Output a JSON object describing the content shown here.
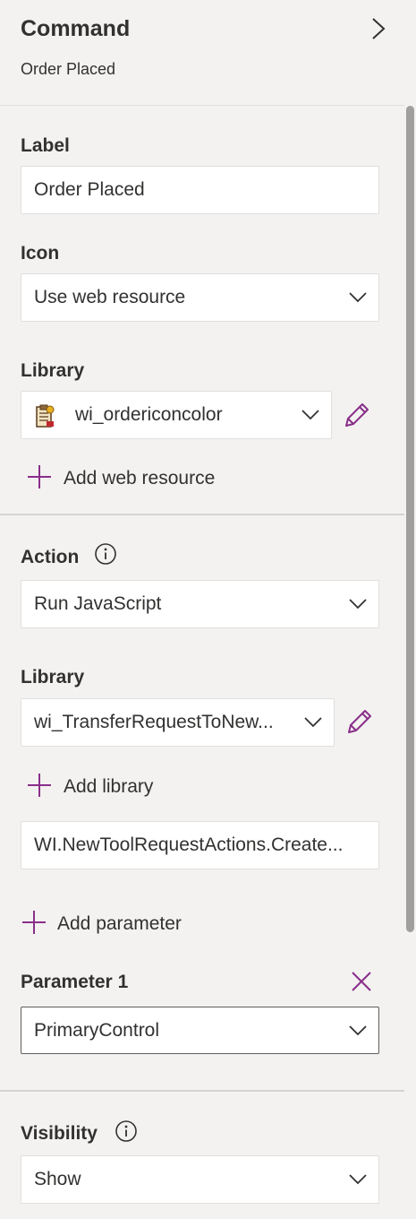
{
  "header": {
    "title": "Command",
    "subtitle": "Order Placed",
    "collapse_icon": "chevron-right-icon"
  },
  "label_section": {
    "label": "Label",
    "value": "Order Placed"
  },
  "icon_section": {
    "label": "Icon",
    "selected": "Use web resource"
  },
  "library_section": {
    "label": "Library",
    "selected": "wi_ordericoncolor",
    "library_icon": "clipboard-icon",
    "add_label": "Add web resource"
  },
  "action_section": {
    "label": "Action",
    "selected": "Run JavaScript",
    "library_label": "Library",
    "library_selected": "wi_TransferRequestToNew...",
    "add_library_label": "Add library",
    "function_value": "WI.NewToolRequestActions.Create...",
    "add_parameter_label": "Add parameter",
    "parameter_label": "Parameter 1",
    "parameter_selected": "PrimaryControl"
  },
  "visibility_section": {
    "label": "Visibility",
    "selected": "Show"
  },
  "colors": {
    "accent": "#8a2f8a",
    "background": "#f3f2f1",
    "text": "#323130"
  }
}
